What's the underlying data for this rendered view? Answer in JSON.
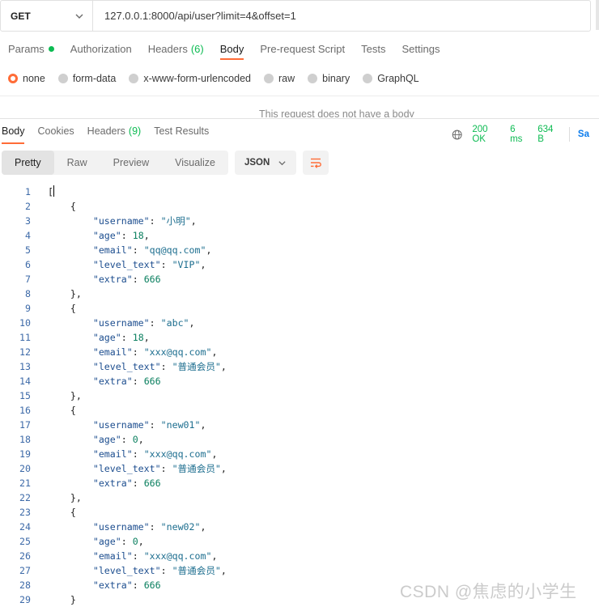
{
  "request": {
    "method": "GET",
    "url": "127.0.0.1:8000/api/user?limit=4&offset=1"
  },
  "request_tabs": [
    {
      "label": "Params",
      "count": "",
      "dot": true
    },
    {
      "label": "Authorization",
      "count": ""
    },
    {
      "label": "Headers",
      "count": "(6)"
    },
    {
      "label": "Body",
      "count": "",
      "active": true
    },
    {
      "label": "Pre-request Script",
      "count": ""
    },
    {
      "label": "Tests",
      "count": ""
    },
    {
      "label": "Settings",
      "count": ""
    }
  ],
  "body_types": [
    {
      "label": "none",
      "selected": true
    },
    {
      "label": "form-data"
    },
    {
      "label": "x-www-form-urlencoded"
    },
    {
      "label": "raw"
    },
    {
      "label": "binary"
    },
    {
      "label": "GraphQL"
    }
  ],
  "no_body_message": "This request does not have a body",
  "response_tabs": [
    {
      "label": "Body",
      "count": "",
      "active": true
    },
    {
      "label": "Cookies",
      "count": ""
    },
    {
      "label": "Headers",
      "count": "(9)"
    },
    {
      "label": "Test Results",
      "count": ""
    }
  ],
  "response_status": {
    "status": "200 OK",
    "time": "6 ms",
    "size": "634 B",
    "save_label": "Sa"
  },
  "view_modes": [
    "Pretty",
    "Raw",
    "Preview",
    "Visualize"
  ],
  "active_view_mode": "Pretty",
  "format_select": "JSON",
  "colors": {
    "accent": "#ff6c37",
    "success": "#0cbb52",
    "link": "#097bed"
  },
  "code_lines": [
    {
      "n": "1",
      "text": "[",
      "cursor": true
    },
    {
      "n": "2",
      "text": "    {"
    },
    {
      "n": "3",
      "key": "username",
      "val": "\"小明\"",
      "t": "s",
      "comma": true
    },
    {
      "n": "4",
      "key": "age",
      "val": "18",
      "t": "n",
      "comma": true
    },
    {
      "n": "5",
      "key": "email",
      "val": "\"qq@qq.com\"",
      "t": "s",
      "comma": true
    },
    {
      "n": "6",
      "key": "level_text",
      "val": "\"VIP\"",
      "t": "s",
      "comma": true
    },
    {
      "n": "7",
      "key": "extra",
      "val": "666",
      "t": "n",
      "comma": false
    },
    {
      "n": "8",
      "text": "    },"
    },
    {
      "n": "9",
      "text": "    {"
    },
    {
      "n": "10",
      "key": "username",
      "val": "\"abc\"",
      "t": "s",
      "comma": true
    },
    {
      "n": "11",
      "key": "age",
      "val": "18",
      "t": "n",
      "comma": true
    },
    {
      "n": "12",
      "key": "email",
      "val": "\"xxx@qq.com\"",
      "t": "s",
      "comma": true
    },
    {
      "n": "13",
      "key": "level_text",
      "val": "\"普通会员\"",
      "t": "s",
      "comma": true
    },
    {
      "n": "14",
      "key": "extra",
      "val": "666",
      "t": "n",
      "comma": false
    },
    {
      "n": "15",
      "text": "    },"
    },
    {
      "n": "16",
      "text": "    {"
    },
    {
      "n": "17",
      "key": "username",
      "val": "\"new01\"",
      "t": "s",
      "comma": true
    },
    {
      "n": "18",
      "key": "age",
      "val": "0",
      "t": "n",
      "comma": true
    },
    {
      "n": "19",
      "key": "email",
      "val": "\"xxx@qq.com\"",
      "t": "s",
      "comma": true
    },
    {
      "n": "20",
      "key": "level_text",
      "val": "\"普通会员\"",
      "t": "s",
      "comma": true
    },
    {
      "n": "21",
      "key": "extra",
      "val": "666",
      "t": "n",
      "comma": false
    },
    {
      "n": "22",
      "text": "    },"
    },
    {
      "n": "23",
      "text": "    {"
    },
    {
      "n": "24",
      "key": "username",
      "val": "\"new02\"",
      "t": "s",
      "comma": true
    },
    {
      "n": "25",
      "key": "age",
      "val": "0",
      "t": "n",
      "comma": true
    },
    {
      "n": "26",
      "key": "email",
      "val": "\"xxx@qq.com\"",
      "t": "s",
      "comma": true
    },
    {
      "n": "27",
      "key": "level_text",
      "val": "\"普通会员\"",
      "t": "s",
      "comma": true
    },
    {
      "n": "28",
      "key": "extra",
      "val": "666",
      "t": "n",
      "comma": false
    },
    {
      "n": "29",
      "text": "    }"
    }
  ],
  "watermark": "CSDN @焦虑的小学生"
}
